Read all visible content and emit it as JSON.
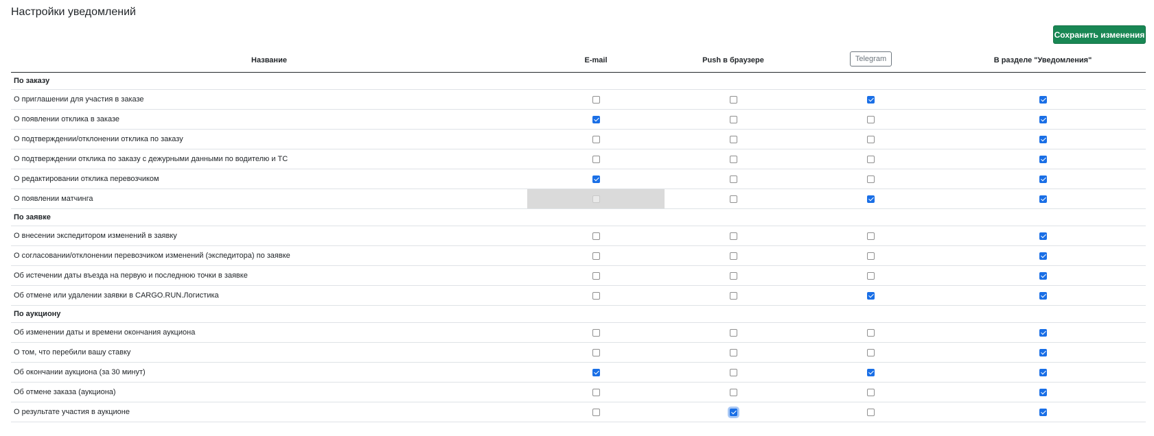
{
  "page": {
    "title": "Настройки уведомлений"
  },
  "toolbar": {
    "save_label": "Сохранить изменения"
  },
  "columns": {
    "name": "Название",
    "email": "E-mail",
    "push": "Push в браузере",
    "telegram": "Telegram",
    "notifications": "В разделе \"Уведомления\""
  },
  "sections": [
    {
      "title": "По заказу",
      "rows": [
        {
          "label": "О приглашении для участия в заказе",
          "email": false,
          "push": false,
          "telegram": true,
          "notifications": true
        },
        {
          "label": "О появлении отклика в заказе",
          "email": true,
          "push": false,
          "telegram": false,
          "notifications": true
        },
        {
          "label": "О подтверждении/отклонении отклика по заказу",
          "email": false,
          "push": false,
          "telegram": false,
          "notifications": true
        },
        {
          "label": "О подтверждении отклика по заказу с дежурными данными по водителю и ТС",
          "email": false,
          "push": false,
          "telegram": false,
          "notifications": true
        },
        {
          "label": "О редактировании отклика перевозчиком",
          "email": true,
          "push": false,
          "telegram": false,
          "notifications": true
        },
        {
          "label": "О появлении матчинга",
          "email": false,
          "email_disabled": true,
          "push": false,
          "telegram": true,
          "notifications": true
        }
      ]
    },
    {
      "title": "По заявке",
      "rows": [
        {
          "label": "О внесении экспедитором изменений в заявку",
          "email": false,
          "push": false,
          "telegram": false,
          "notifications": true
        },
        {
          "label": "О согласовании/отклонении перевозчиком изменений (экспедитора) по заявке",
          "email": false,
          "push": false,
          "telegram": false,
          "notifications": true
        },
        {
          "label": "Об истечении даты въезда на первую и последнюю точки в заявке",
          "email": false,
          "push": false,
          "telegram": false,
          "notifications": true
        },
        {
          "label": "Об отмене или удалении заявки в CARGO.RUN.Логистика",
          "email": false,
          "push": false,
          "telegram": true,
          "notifications": true
        }
      ]
    },
    {
      "title": "По аукциону",
      "rows": [
        {
          "label": "Об изменении даты и времени окончания аукциона",
          "email": false,
          "push": false,
          "telegram": false,
          "notifications": true
        },
        {
          "label": "О том, что перебили вашу ставку",
          "email": false,
          "push": false,
          "telegram": false,
          "notifications": true
        },
        {
          "label": "Об окончании аукциона (за 30 минут)",
          "email": true,
          "push": false,
          "telegram": true,
          "notifications": true
        },
        {
          "label": "Об отмене заказа (аукциона)",
          "email": false,
          "push": false,
          "telegram": false,
          "notifications": true
        },
        {
          "label": "О результате участия в аукционе",
          "email": false,
          "push": true,
          "push_focused": true,
          "telegram": false,
          "notifications": true
        }
      ]
    }
  ],
  "colors": {
    "accent": "#1a6fe6",
    "save_button": "#198754",
    "disabled_cell": "#dadada"
  }
}
